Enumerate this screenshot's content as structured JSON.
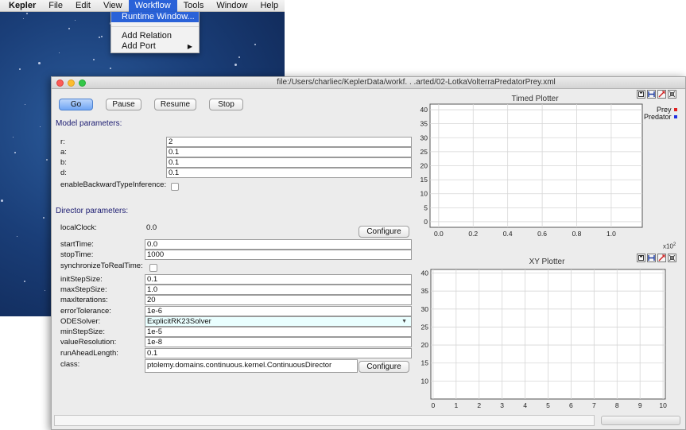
{
  "menubar": {
    "app": "Kepler",
    "items": [
      "File",
      "Edit",
      "View",
      "Workflow",
      "Tools",
      "Window",
      "Help"
    ],
    "active": "Workflow"
  },
  "workflow_menu": {
    "items": [
      {
        "label": "Runtime Window...",
        "highlighted": true,
        "submenu": false
      },
      {
        "label": "Add Relation",
        "highlighted": false,
        "submenu": false
      },
      {
        "label": "Add Port",
        "highlighted": false,
        "submenu": true
      }
    ],
    "submenu_arrow": "▶"
  },
  "window": {
    "title": "file:/Users/charliec/KeplerData/workf. . .arted/02-LotkaVolterraPredatorPrey.xml"
  },
  "controls": {
    "go": "Go",
    "pause": "Pause",
    "resume": "Resume",
    "stop": "Stop"
  },
  "model_params": {
    "heading": "Model parameters:",
    "rows": [
      {
        "label": "r:",
        "value": "2"
      },
      {
        "label": "a:",
        "value": "0.1"
      },
      {
        "label": "b:",
        "value": "0.1"
      },
      {
        "label": "d:",
        "value": "0.1"
      }
    ],
    "backward_label": "enableBackwardTypeInference:",
    "backward_checked": false
  },
  "director_params": {
    "heading": "Director parameters:",
    "local_clock_label": "localClock:",
    "local_clock_value": "0.0",
    "configure": "Configure",
    "start_time_label": "startTime:",
    "start_time": "0.0",
    "stop_time_label": "stopTime:",
    "stop_time": "1000",
    "sync_label": "synchronizeToRealTime:",
    "sync_checked": false,
    "init_step_label": "initStepSize:",
    "init_step": "0.1",
    "max_step_label": "maxStepSize:",
    "max_step": "1.0",
    "max_iter_label": "maxIterations:",
    "max_iter": "20",
    "err_tol_label": "errorTolerance:",
    "err_tol": "1e-6",
    "ode_label": "ODESolver:",
    "ode_value": "ExplicitRK23Solver",
    "ode_arrow": "▼",
    "min_step_label": "minStepSize:",
    "min_step": "1e-5",
    "value_res_label": "valueResolution:",
    "value_res": "1e-8",
    "run_ahead_label": "runAheadLength:",
    "run_ahead": "0.1",
    "class_label": "class:",
    "class_value": "ptolemy.domains.continuous.kernel.ContinuousDirector"
  },
  "plot_icons": [
    "save-icon",
    "fill-icon",
    "reset-axes-icon",
    "format-icon"
  ],
  "chart_data": [
    {
      "type": "line",
      "title": "Timed Plotter",
      "xlabel": "",
      "ylabel": "",
      "xlim": [
        -0.05,
        1.18
      ],
      "ylim": [
        -2,
        42
      ],
      "x_ticks": [
        "0.0",
        "0.2",
        "0.4",
        "0.6",
        "0.8",
        "1.0"
      ],
      "y_ticks": [
        "0",
        "5",
        "10",
        "15",
        "20",
        "25",
        "30",
        "35",
        "40"
      ],
      "x_exponent_base": "x10",
      "x_exponent_power": "2",
      "grid": true,
      "legend_position": "top-right",
      "series": [
        {
          "name": "Prey",
          "color": "#e02020",
          "values": []
        },
        {
          "name": "Predator",
          "color": "#2030e0",
          "values": []
        }
      ]
    },
    {
      "type": "scatter",
      "title": "XY Plotter",
      "xlabel": "",
      "ylabel": "",
      "xlim": [
        -0.1,
        10.1
      ],
      "ylim": [
        5,
        41
      ],
      "x_ticks": [
        "0",
        "1",
        "2",
        "3",
        "4",
        "5",
        "6",
        "7",
        "8",
        "9",
        "10"
      ],
      "y_ticks": [
        "10",
        "15",
        "20",
        "25",
        "30",
        "35",
        "40"
      ],
      "grid": true,
      "series": []
    }
  ]
}
